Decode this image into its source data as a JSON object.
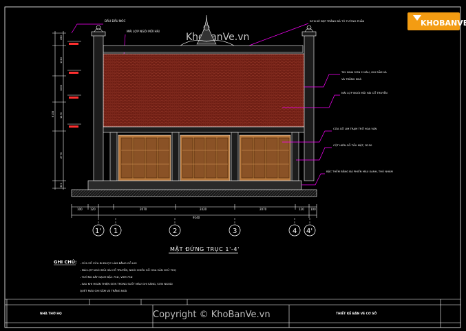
{
  "logo": {
    "text": "KHOBANVE",
    "colors": {
      "bg": "#f39c12",
      "fg": "#ffffff"
    }
  },
  "watermarks": {
    "top": "KhoBanVe.vn",
    "bottom": "Copyright © KhoBanVe.vn"
  },
  "labels_left": {
    "dau_dau_noc": "ĐẦU ĐẦU NÓC",
    "mai_lop": "MÁI LỢP NGÓI MŨI HÀI"
  },
  "labels_right": {
    "top": "SƠN KẺ ĐẸP TRẮNG ĐÃ TÔ TƯỜNG PHẦN",
    "tay_ngai": "TAY NGAI SƠN 2 MÀU, GHI SẦM VÀ",
    "tay_ngai2": "VÀ TRẮNG NGÀ",
    "mai_lop_ngoi": "MÁI LỢP NGÓI MŨI HÀI CỔ TRUYỀN",
    "cua_go": "CỬA GỖ LIM TRẠM TRỔ HOA VĂN",
    "cot_hien": "CỘT HIÊN GỖ TẨU MẬT, D250",
    "bac_them": "BẬC THỀM BẰNG ĐÁ PHIẾN MÀU XANH, THÔ NHÁM"
  },
  "dims_left": [
    "450",
    "1010",
    "1000",
    "1470",
    "2770",
    "300"
  ],
  "dims_left_total": "6135",
  "dims_bottom": [
    "100",
    "120",
    "2070",
    "2420",
    "2070",
    "120",
    "100"
  ],
  "dims_bottom_total": "9140",
  "axes": [
    "1'",
    "1",
    "2",
    "3",
    "4",
    "4'"
  ],
  "title": "MẶT ĐỨNG TRỤC 1'-4'",
  "notes": {
    "heading": "GHI CHÚ:",
    "lines": [
      "- CỬA SỔ CỬA ĐI ĐƯỢC LÀM BẰNG GỖ LIM",
      "- MÁI LỢP NGÓI MŨI HÀI CỔ TRUYỀN, NGÓI CHIẾU GỖ HOA VĂN CHỮ THỌ",
      "- TƯỜNG XÂY GẠCH ĐẶC 75#, VXM 75#",
      "- SAU KHI HOÀN THIỆN SƠN TRONG SUỐT MÀU GHI SÁNG, SƠN NGOÀI",
      "  QUÉT MÀU GHI SẦM VÀ TRẮNG NGÀ"
    ]
  },
  "title_block": {
    "left": "NHÀ THỜ HỌ",
    "right": "THIẾT KẾ BẢN VẼ CƠ SỞ"
  },
  "colors": {
    "background": "#000000",
    "roof": "#6e1e14",
    "roof_pattern": "#8c2f22",
    "door": "#b8783c",
    "door_panel": "#8a5226",
    "wall": "#d8d8d8",
    "callout": "#ff00ff",
    "dim": "#ffffff",
    "annotation_red": "#ff3030"
  }
}
